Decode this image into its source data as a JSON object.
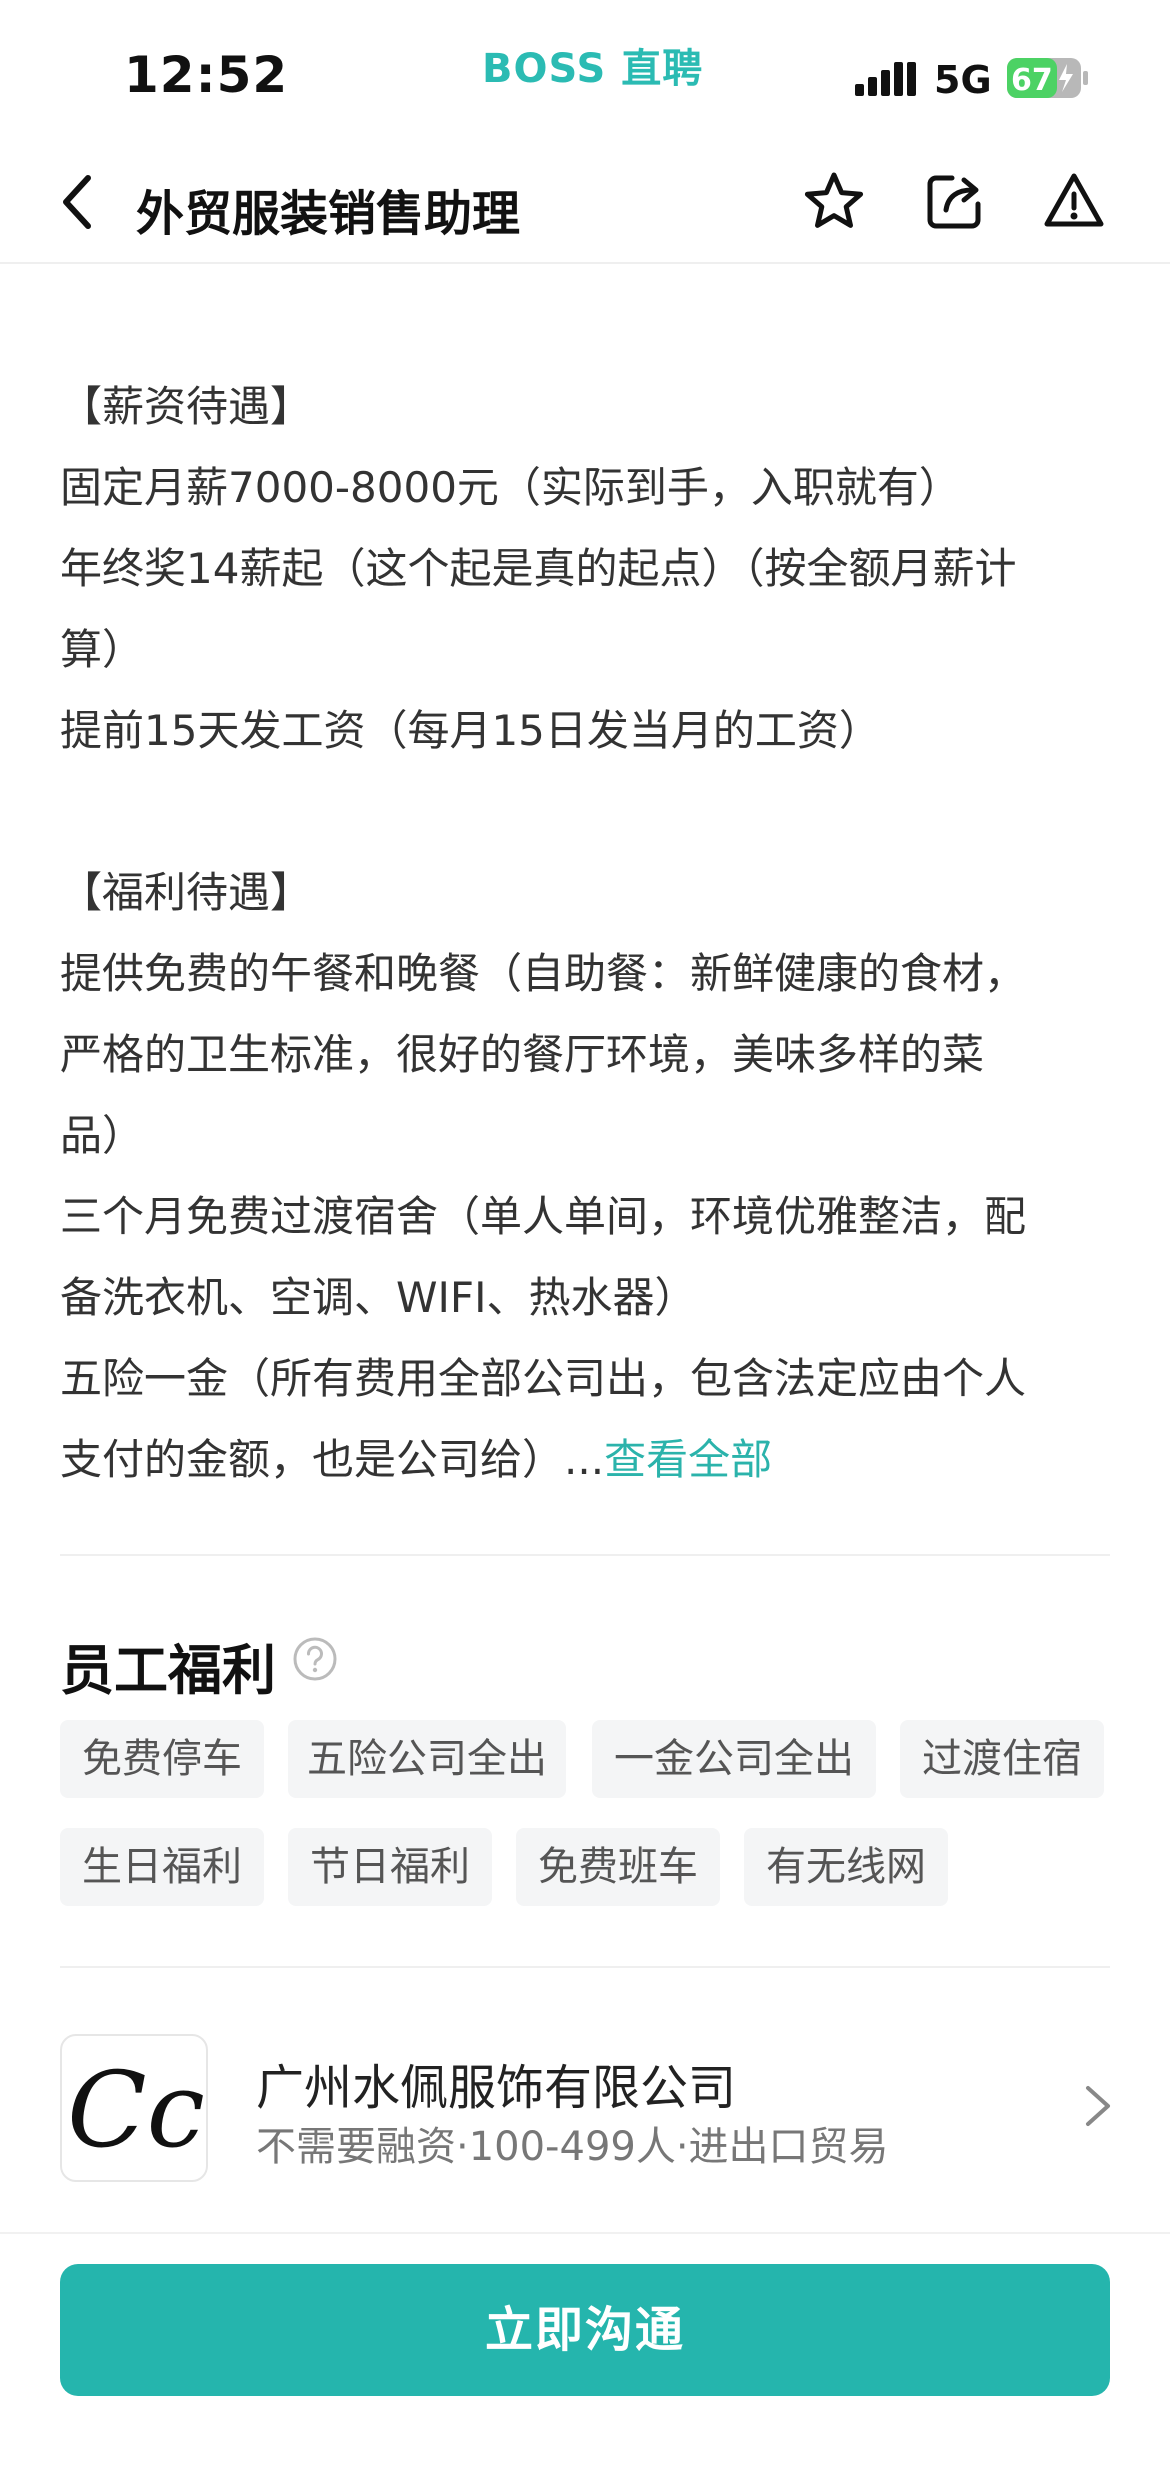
{
  "status_bar": {
    "time": "12:52",
    "brand": "BOSS 直聘",
    "network": "5G",
    "battery": "67"
  },
  "nav": {
    "title": "外贸服装销售助理",
    "icons": [
      "back-arrow-icon",
      "star-icon",
      "share-icon",
      "warning-icon"
    ]
  },
  "description": {
    "lines": [
      "【薪资待遇】",
      "固定月薪7000-8000元（实际到手，入职就有）",
      "年终奖14薪起（这个起是真的起点）（按全额月薪计",
      "算）",
      "提前15天发工资（每月15日发当月的工资）",
      "",
      "【福利待遇】",
      "提供免费的午餐和晚餐（自助餐：新鲜健康的食材，",
      "严格的卫生标准，很好的餐厅环境，美味多样的菜",
      "品）",
      "三个月免费过渡宿舍（单人单间，环境优雅整洁，配",
      "备洗衣机、空调、WIFI、热水器）",
      "五险一金（所有费用全部公司出，包含法定应由个人"
    ],
    "last_line": "支付的金额，也是公司给）...",
    "more_link": "查看全部"
  },
  "benefits": {
    "title": "员工福利",
    "help_icon": "question-circle-icon",
    "tags": [
      "免费停车",
      "五险公司全出",
      "一金公司全出",
      "过渡住宿",
      "生日福利",
      "节日福利",
      "免费班车",
      "有无线网"
    ]
  },
  "company": {
    "logo_text": "Cc",
    "name": "广州水佩服饰有限公司",
    "meta": "不需要融资·100-499人·进出口贸易"
  },
  "cta": {
    "label": "立即沟通"
  },
  "colors": {
    "brand": "#2bbbb3",
    "link": "#2bb3ab",
    "button": "#25b5ad",
    "tag_bg": "#f4f5f6"
  }
}
